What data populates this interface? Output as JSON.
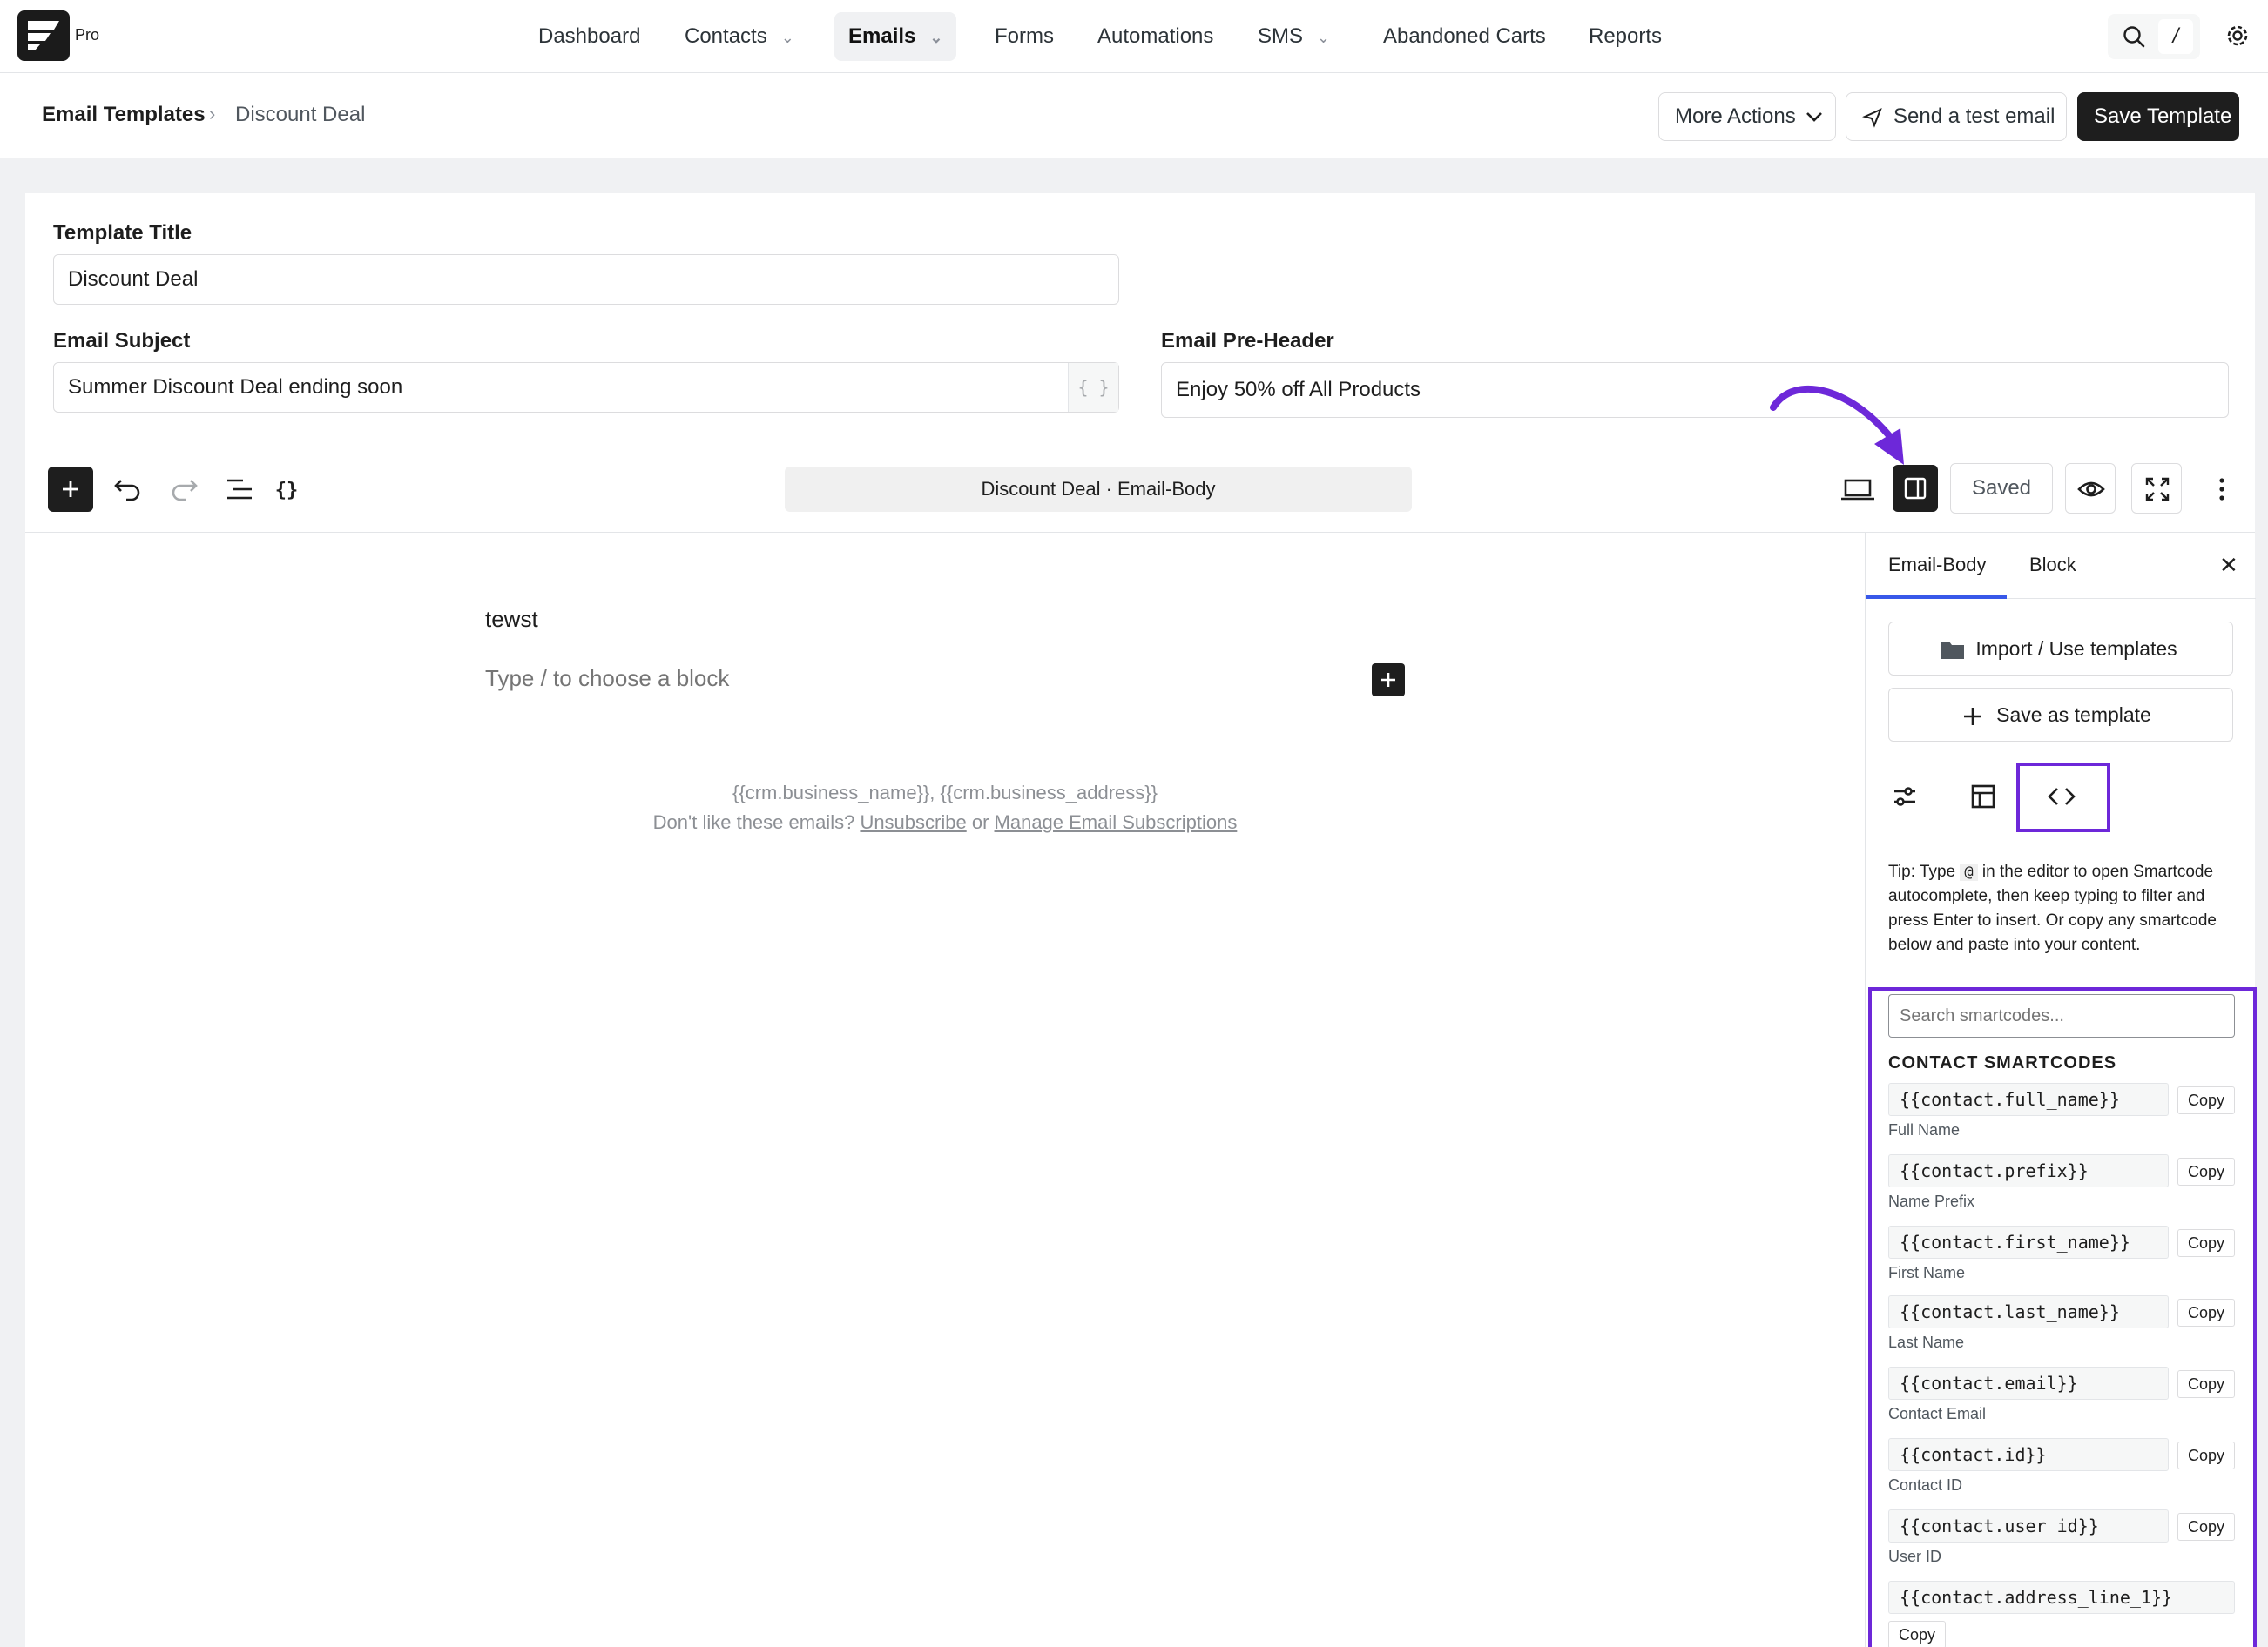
{
  "brand": {
    "tier": "Pro"
  },
  "nav": {
    "items": [
      {
        "label": "Dashboard",
        "has_chevron": false,
        "active": false
      },
      {
        "label": "Contacts",
        "has_chevron": true,
        "active": false
      },
      {
        "label": "Emails",
        "has_chevron": true,
        "active": true
      },
      {
        "label": "Forms",
        "has_chevron": false,
        "active": false
      },
      {
        "label": "Automations",
        "has_chevron": false,
        "active": false
      },
      {
        "label": "SMS",
        "has_chevron": true,
        "active": false
      },
      {
        "label": "Abandoned Carts",
        "has_chevron": false,
        "active": false
      },
      {
        "label": "Reports",
        "has_chevron": false,
        "active": false
      }
    ],
    "search_shortcut": "/"
  },
  "breadcrumb": {
    "parent": "Email Templates",
    "current": "Discount Deal"
  },
  "header_actions": {
    "more_actions": "More Actions",
    "send_test": "Send a test email",
    "save": "Save Template"
  },
  "form": {
    "title_label": "Template Title",
    "title_value": "Discount Deal",
    "subject_label": "Email Subject",
    "subject_value": "Summer Discount Deal ending soon",
    "smartcode_glyph": "{ }",
    "preheader_label": "Email Pre-Header",
    "preheader_value": "Enjoy 50% off All Products"
  },
  "editor": {
    "document_title": "Discount Deal · Email-Body",
    "saved_label": "Saved",
    "content_text": "tewst",
    "block_placeholder": "Type / to choose a block",
    "footer_line1": "{{crm.business_name}}, {{crm.business_address}}",
    "footer_prefix": "Don't like these emails? ",
    "footer_unsubscribe": "Unsubscribe",
    "footer_or": " or ",
    "footer_manage": "Manage Email Subscriptions"
  },
  "sidebar": {
    "tabs": [
      "Email-Body",
      "Block"
    ],
    "import_label": "Import / Use templates",
    "save_as_label": "Save as template",
    "tip_part1": "Tip: Type ",
    "tip_code": "@",
    "tip_part2": " in the editor to open Smartcode autocomplete, then keep typing to filter and press Enter to insert.  Or copy any smartcode below and paste into your content.",
    "search_placeholder": "Search smartcodes...",
    "section_heading": "CONTACT SMARTCODES",
    "copy_label": "Copy",
    "smartcodes": [
      {
        "code": "{{contact.full_name}}",
        "desc": "Full Name"
      },
      {
        "code": "{{contact.prefix}}",
        "desc": "Name Prefix"
      },
      {
        "code": "{{contact.first_name}}",
        "desc": "First Name"
      },
      {
        "code": "{{contact.last_name}}",
        "desc": "Last Name"
      },
      {
        "code": "{{contact.email}}",
        "desc": "Contact Email"
      },
      {
        "code": "{{contact.id}}",
        "desc": "Contact ID"
      },
      {
        "code": "{{contact.user_id}}",
        "desc": "User ID"
      },
      {
        "code": "{{contact.address_line_1}}",
        "desc": ""
      }
    ]
  },
  "colors": {
    "accent": "#3858e9",
    "highlight": "#6d28d9",
    "dark": "#1e1e1e"
  }
}
